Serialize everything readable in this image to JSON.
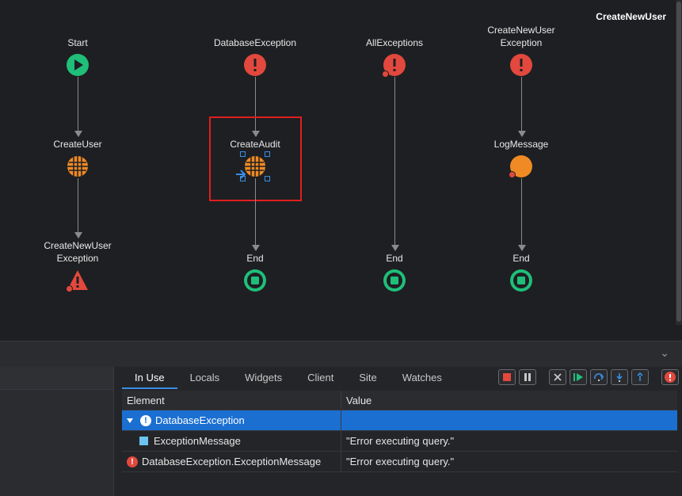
{
  "flow": {
    "title": "CreateNewUser",
    "columns": [
      {
        "start": "Start",
        "middle": "CreateUser",
        "end_line1": "CreateNewUser",
        "end_line2": "Exception"
      },
      {
        "start": "DatabaseException",
        "middle": "CreateAudit",
        "end": "End"
      },
      {
        "start": "AllExceptions",
        "end": "End"
      },
      {
        "start_line1": "CreateNewUser",
        "start_line2": "Exception",
        "middle": "LogMessage",
        "end": "End"
      }
    ],
    "colors": {
      "start": "#1fbf7a",
      "exception": "#e2483d",
      "action": "#f08a24",
      "end": "#1fbf7a",
      "selection": "#e01e1e"
    }
  },
  "debugger": {
    "tabs": [
      "In Use",
      "Locals",
      "Widgets",
      "Client",
      "Site",
      "Watches"
    ],
    "active_tab": "In Use",
    "toolbar_icons": [
      "stop-icon",
      "pause-icon",
      "abort-icon",
      "continue-icon",
      "step-over-icon",
      "step-into-icon",
      "step-out-icon",
      "break-on-exception-icon"
    ],
    "columns": {
      "element": "Element",
      "value": "Value"
    },
    "rows": [
      {
        "element": "DatabaseException",
        "value": "",
        "selected": true
      },
      {
        "element": "ExceptionMessage",
        "value": "\"Error executing query.\""
      },
      {
        "element": "DatabaseException.ExceptionMessage",
        "value": "\"Error executing query.\""
      }
    ]
  }
}
